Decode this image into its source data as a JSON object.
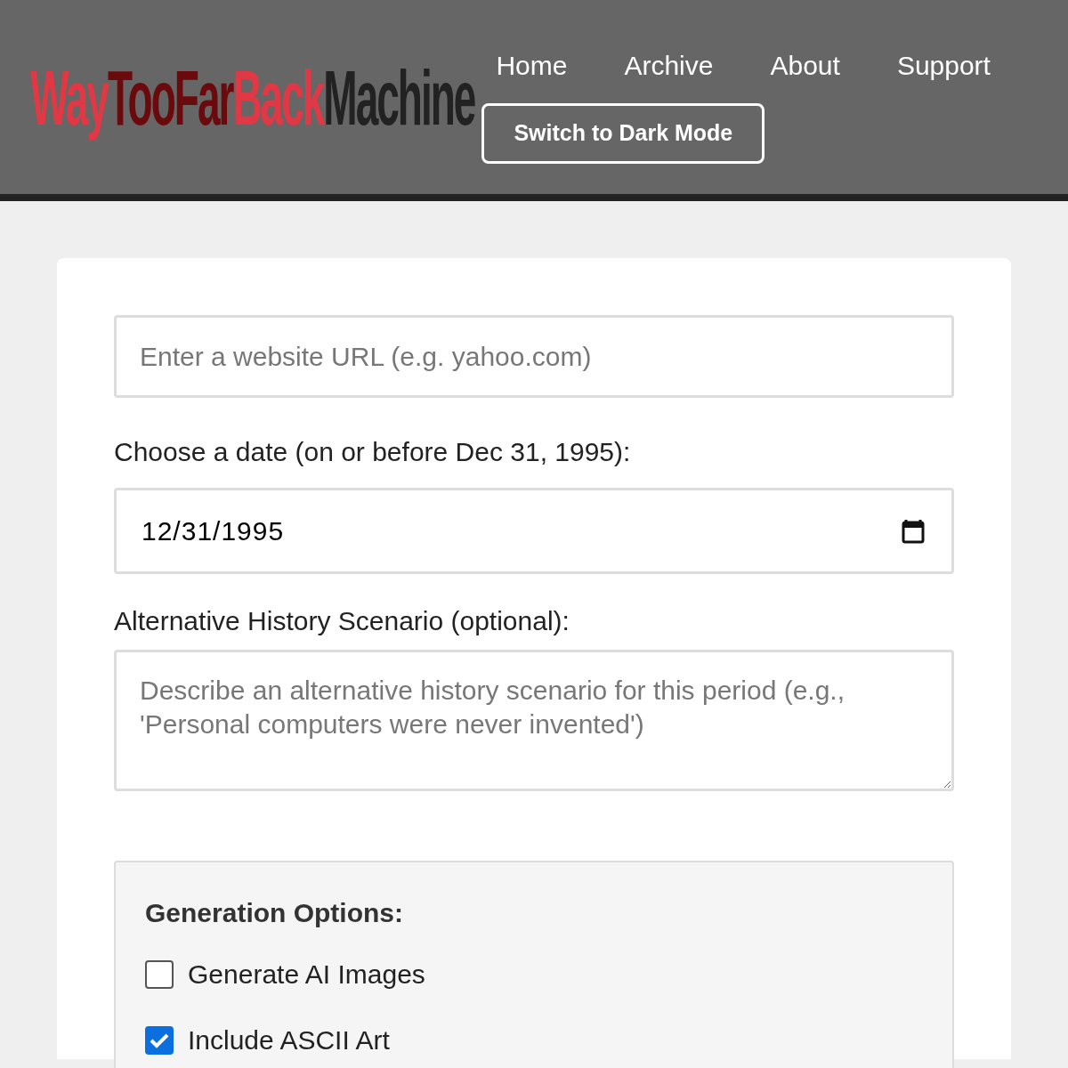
{
  "logo": {
    "parts": [
      {
        "text": "Way",
        "color": "#e03844"
      },
      {
        "text": "Too",
        "color": "#6a0a0c"
      },
      {
        "text": "Far",
        "color": "#6a0a0c"
      },
      {
        "text": "Back",
        "color": "#e03844"
      },
      {
        "text": "Machine",
        "color": "#222222"
      }
    ]
  },
  "nav": {
    "links": [
      "Home",
      "Archive",
      "About",
      "Support"
    ],
    "theme_button": "Switch to Dark Mode"
  },
  "form": {
    "url_field": {
      "placeholder": "Enter a website URL (e.g. yahoo.com)"
    },
    "date_label": "Choose a date (on or before Dec 31, 1995):",
    "date_field": {
      "value": "12/31/1995"
    },
    "scenario_label": "Alternative History Scenario (optional):",
    "scenario_field": {
      "placeholder": "Describe an alternative history scenario for this period (e.g., 'Personal computers were never invented')"
    },
    "options": {
      "title": "Generation Options:",
      "items": [
        {
          "label": "Generate AI Images",
          "checked": false
        },
        {
          "label": "Include ASCII Art",
          "checked": true
        }
      ]
    }
  }
}
